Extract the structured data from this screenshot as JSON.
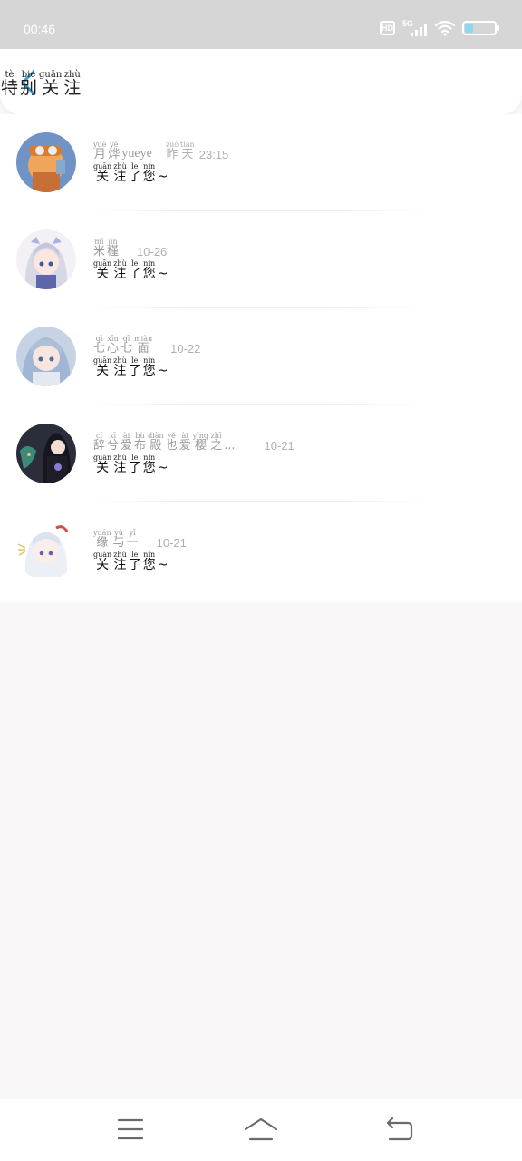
{
  "status_bar": {
    "time": "00:46",
    "hd_label": "HD",
    "network_label": "5G",
    "icons": [
      "hd-icon",
      "signal-icon",
      "wifi-icon",
      "battery-icon"
    ],
    "battery_level": 0.25,
    "battery_fill_color": "#8fd6f0"
  },
  "header": {
    "back_icon": "chevron-left-icon",
    "accent_color": "#2a9fe0",
    "title": [
      {
        "char": "特",
        "pinyin": "tè"
      },
      {
        "char": "别",
        "pinyin": "bié"
      },
      {
        "char": "关",
        "pinyin": "guān"
      },
      {
        "char": "注",
        "pinyin": "zhù"
      }
    ]
  },
  "items": [
    {
      "name": [
        {
          "char": "月",
          "pinyin": "yuè"
        },
        {
          "char": "烨",
          "pinyin": "yè"
        }
      ],
      "name_suffix": "yueye",
      "time_prefix": [
        {
          "char": "昨",
          "pinyin": "zuó"
        },
        {
          "char": "天",
          "pinyin": "tiān"
        }
      ],
      "time": "23:15",
      "message": [
        {
          "char": "关",
          "pinyin": "guān"
        },
        {
          "char": "注",
          "pinyin": "zhù"
        },
        {
          "char": "了",
          "pinyin": "le"
        },
        {
          "char": "您",
          "pinyin": "nín"
        }
      ],
      "message_suffix": "~"
    },
    {
      "name": [
        {
          "char": "米",
          "pinyin": "mǐ"
        },
        {
          "char": "槿",
          "pinyin": "jǐn"
        }
      ],
      "name_suffix": "",
      "time_prefix": [],
      "time": "10-26",
      "message": [
        {
          "char": "关",
          "pinyin": "guān"
        },
        {
          "char": "注",
          "pinyin": "zhù"
        },
        {
          "char": "了",
          "pinyin": "le"
        },
        {
          "char": "您",
          "pinyin": "nín"
        }
      ],
      "message_suffix": "~"
    },
    {
      "name": [
        {
          "char": "七",
          "pinyin": "qī"
        },
        {
          "char": "心",
          "pinyin": "xīn"
        },
        {
          "char": "七",
          "pinyin": "qī"
        },
        {
          "char": "面",
          "pinyin": "miàn"
        }
      ],
      "name_suffix": "",
      "time_prefix": [],
      "time": "10-22",
      "message": [
        {
          "char": "关",
          "pinyin": "guān"
        },
        {
          "char": "注",
          "pinyin": "zhù"
        },
        {
          "char": "了",
          "pinyin": "le"
        },
        {
          "char": "您",
          "pinyin": "nín"
        }
      ],
      "message_suffix": "~"
    },
    {
      "name": [
        {
          "char": "辞",
          "pinyin": "cí"
        },
        {
          "char": "兮",
          "pinyin": "xī"
        },
        {
          "char": "爱",
          "pinyin": "ài"
        },
        {
          "char": "布",
          "pinyin": "bù"
        },
        {
          "char": "殿",
          "pinyin": "diàn"
        },
        {
          "char": "也",
          "pinyin": "yě"
        },
        {
          "char": "爱",
          "pinyin": "ài"
        },
        {
          "char": "樱",
          "pinyin": "yīng"
        },
        {
          "char": "之",
          "pinyin": "zhī"
        }
      ],
      "name_suffix": "...",
      "time_prefix": [],
      "time": "10-21",
      "message": [
        {
          "char": "关",
          "pinyin": "guān"
        },
        {
          "char": "注",
          "pinyin": "zhù"
        },
        {
          "char": "了",
          "pinyin": "le"
        },
        {
          "char": "您",
          "pinyin": "nín"
        }
      ],
      "message_suffix": "~"
    },
    {
      "name": [
        {
          "char": "缘",
          "pinyin": "yuán"
        },
        {
          "char": "与",
          "pinyin": "yǔ"
        },
        {
          "char": "一",
          "pinyin": "yī"
        }
      ],
      "name_suffix": "",
      "time_prefix": [],
      "time": "10-21",
      "message": [
        {
          "char": "关",
          "pinyin": "guān"
        },
        {
          "char": "注",
          "pinyin": "zhù"
        },
        {
          "char": "了",
          "pinyin": "le"
        },
        {
          "char": "您",
          "pinyin": "nín"
        }
      ],
      "message_suffix": "~"
    }
  ],
  "navbar": {
    "icons": [
      "menu-icon",
      "home-icon",
      "back-nav-icon"
    ]
  }
}
